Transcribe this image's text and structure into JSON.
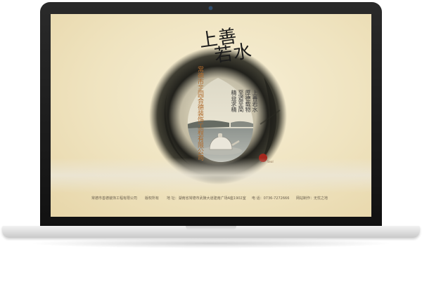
{
  "site": {
    "title_line1": "上善",
    "title_line2": "若水",
    "company_vertical": "常德市芷园合德装饰工程有限公司",
    "motto_lines": [
      "上善若水",
      "厚德载物",
      "至道至简",
      "精益求精"
    ],
    "seal_text": "Seal"
  },
  "footer": {
    "company": "常德市善德装饰工程有限公司",
    "rights": "版权所有",
    "address_label": "地 址：湖南省常德市武陵大道建南广场A座1902室",
    "phone": "电 话：0736-7272666",
    "credit": "网站制作：无忧之地"
  },
  "colors": {
    "paper": "#efe3bf",
    "ink": "#1b1b1b",
    "accent": "#b06a2a",
    "seal": "#a3271d"
  }
}
